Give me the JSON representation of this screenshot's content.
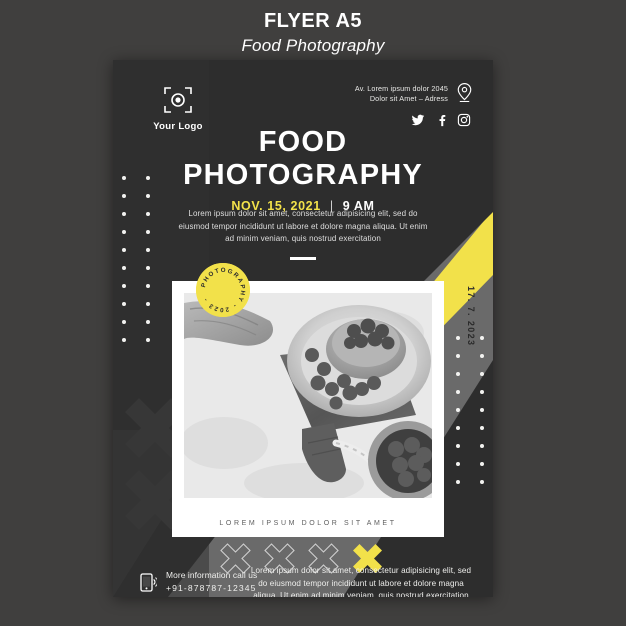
{
  "header": {
    "title": "FLYER A5",
    "subtitle": "Food Photography"
  },
  "colors": {
    "page_background": "#403f3e",
    "poster_dark": "#2d2d2d",
    "poster_mid_gray": "#696969",
    "accent_yellow": "#f2e14a",
    "white": "#ffffff"
  },
  "poster": {
    "logo": {
      "icon": "camera-viewfinder-icon",
      "label": "Your Logo"
    },
    "address": {
      "icon": "location-pin-icon",
      "line1": "Av. Lorem ipsum dolor 2045",
      "line2": "Dolor sit Amet – Adress"
    },
    "socials": [
      {
        "name": "twitter-icon",
        "label": "Twitter"
      },
      {
        "name": "facebook-icon",
        "label": "Facebook"
      },
      {
        "name": "instagram-icon",
        "label": "Instagram"
      }
    ],
    "title": {
      "line1": "FOOD",
      "line2": "PHOTOGRAPHY"
    },
    "event": {
      "date": "NOV. 15, 2021",
      "separator": "|",
      "time": "9 AM"
    },
    "lead_text": "Lorem ipsum dolor sit amet, consectetur adipisicing elit, sed do eiusmod tempor incididunt ut labore et dolore magna aliqua. Ut enim ad minim veniam, quis nostrud exercitation",
    "badge": {
      "text": "PHOTOGRAPHY - 2023 - "
    },
    "photo": {
      "caption": "LOREM IPSUM DOLOR SIT AMET",
      "side_date": "17. 7. 2023",
      "alt": "black and white photo of blueberries on a plate with wooden board"
    },
    "footer": {
      "contact_icon": "phone-icon",
      "contact_label": "More information call us",
      "phone": "+91-878787-12345",
      "text": "Lorem ipsum dolor sit amet, consectetur adipisicing elit, sed do eiusmod tempor incididunt ut labore et dolore magna aliqua. Ut enim ad minim veniam, quis nostrud exercitation"
    }
  }
}
